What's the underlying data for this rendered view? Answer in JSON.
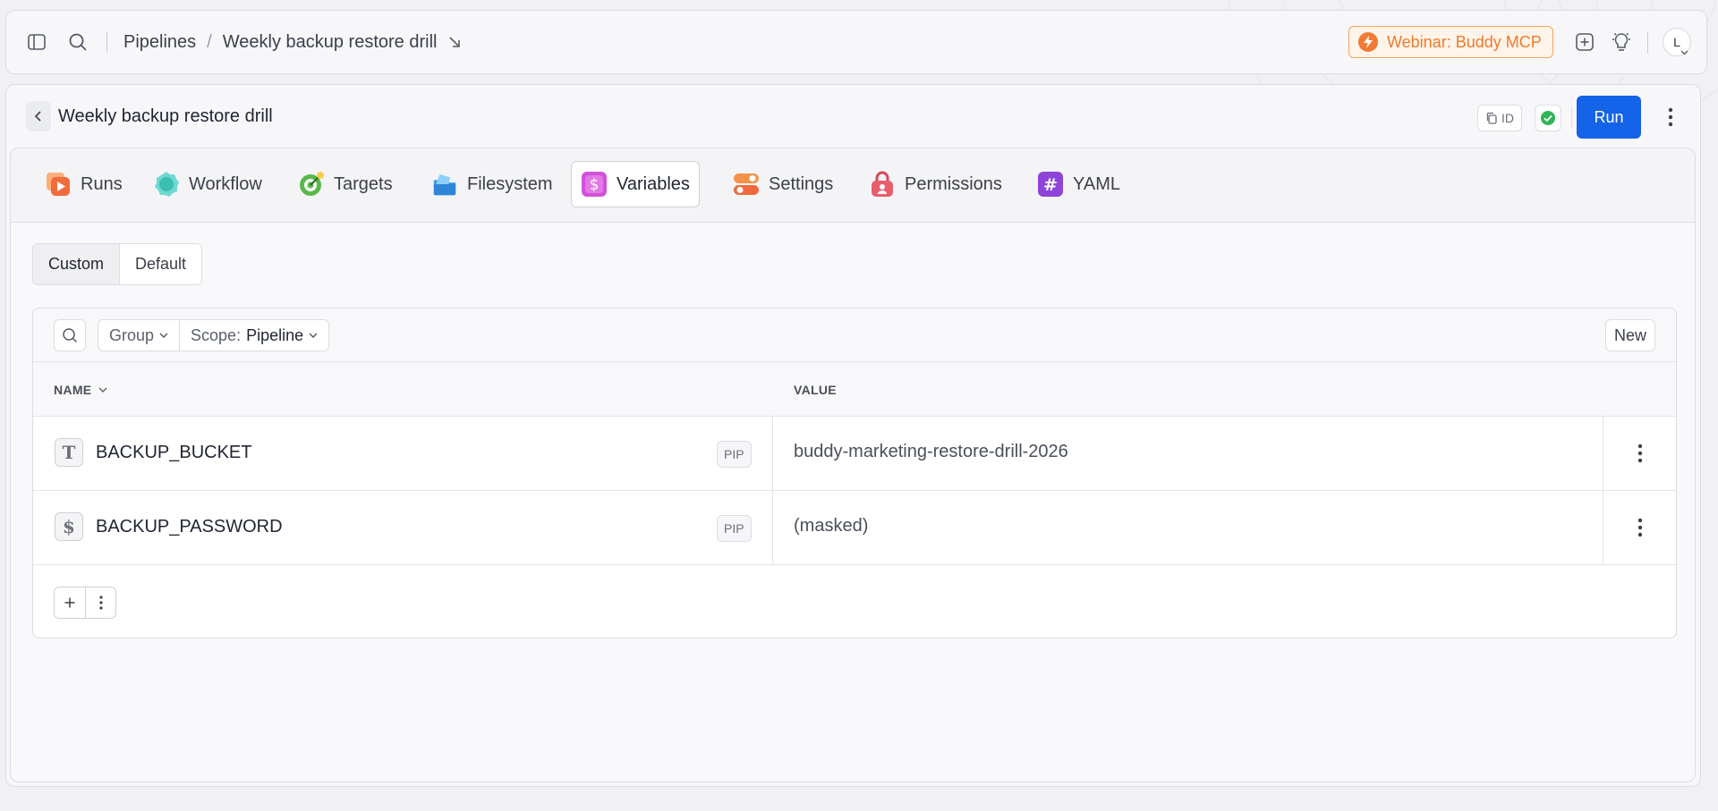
{
  "breadcrumb": {
    "root": "Pipelines",
    "current": "Weekly backup restore drill"
  },
  "promo": {
    "label": "Webinar: Buddy MCP",
    "accent": "#ee7a2c"
  },
  "user": {
    "initial": "L"
  },
  "page": {
    "title": "Weekly backup restore drill",
    "id_label": "ID",
    "run_label": "Run",
    "accent": "#1463e8"
  },
  "tabs": [
    {
      "label": "Runs",
      "icon": "play-icon"
    },
    {
      "label": "Workflow",
      "icon": "workflow-icon"
    },
    {
      "label": "Targets",
      "icon": "target-icon"
    },
    {
      "label": "Filesystem",
      "icon": "filesystem-icon"
    },
    {
      "label": "Variables",
      "icon": "dollar-icon",
      "active": true
    },
    {
      "label": "Settings",
      "icon": "toggle-icon"
    },
    {
      "label": "Permissions",
      "icon": "lock-icon"
    },
    {
      "label": "YAML",
      "icon": "hash-icon"
    }
  ],
  "segment": {
    "custom": "Custom",
    "default": "Default",
    "selected": "Custom"
  },
  "toolbar": {
    "group_label": "Group",
    "scope_prefix": "Scope:",
    "scope_value": "Pipeline",
    "new_label": "New"
  },
  "table": {
    "columns": {
      "name": "NAME",
      "value": "VALUE"
    },
    "rows": [
      {
        "type_glyph": "T",
        "type_icon": "text-type-icon",
        "name": "BACKUP_BUCKET",
        "badge": "PIP",
        "value": "buddy-marketing-restore-drill-2026"
      },
      {
        "type_glyph": "$",
        "type_icon": "secret-type-icon",
        "name": "BACKUP_PASSWORD",
        "badge": "PIP",
        "value": "(masked)"
      }
    ]
  }
}
